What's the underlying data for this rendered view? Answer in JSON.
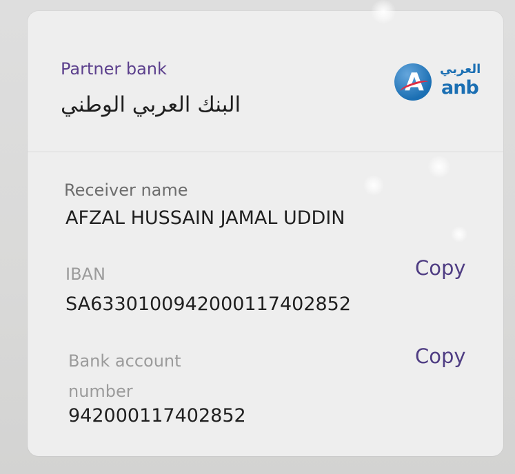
{
  "bank": {
    "partner_label": "Partner bank",
    "name_ar": "البنك العربي الوطني",
    "logo": {
      "ar_text": "العربي",
      "en_text": "anb",
      "accent_color": "#1b6fb3",
      "swoosh_color": "#e02c42"
    }
  },
  "receiver": {
    "label": "Receiver name",
    "value": "AFZAL HUSSAIN JAMAL UDDIN"
  },
  "iban": {
    "label": "IBAN",
    "value": "SA6330100942000117402852",
    "copy_label": "Copy"
  },
  "account": {
    "label_line1": "Bank account",
    "label_line2": "number",
    "value": "942000117402852",
    "copy_label": "Copy"
  },
  "colors": {
    "background": "#dcdcdb",
    "card": "#eeeeee",
    "accent_purple": "#5b3f8c",
    "text_dark": "#1f1f1f",
    "text_muted": "#6d6d6d"
  }
}
